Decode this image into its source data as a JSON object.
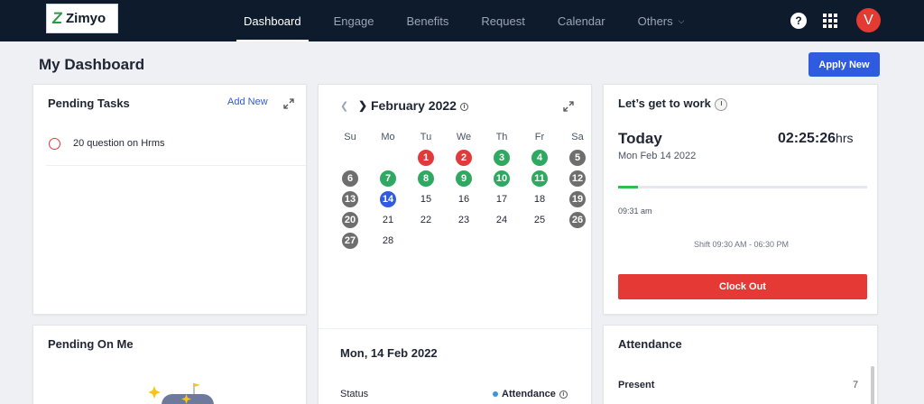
{
  "brand": {
    "name": "Zimyo"
  },
  "nav": {
    "items": [
      {
        "label": "Dashboard",
        "active": true
      },
      {
        "label": "Engage",
        "active": false
      },
      {
        "label": "Benefits",
        "active": false
      },
      {
        "label": "Request",
        "active": false
      },
      {
        "label": "Calendar",
        "active": false
      },
      {
        "label": "Others",
        "active": false
      }
    ],
    "help_glyph": "?",
    "avatar_initial": "V"
  },
  "page": {
    "title": "My Dashboard",
    "apply_new": "Apply New"
  },
  "pending_tasks": {
    "title": "Pending Tasks",
    "add_new": "Add New",
    "items": [
      "20 question on Hrms"
    ]
  },
  "calendar": {
    "month": "February 2022",
    "weekdays": [
      "Su",
      "Mo",
      "Tu",
      "We",
      "Th",
      "Fr",
      "Sa"
    ],
    "leading_blanks": 2,
    "days": [
      {
        "d": "1",
        "s": "absent"
      },
      {
        "d": "2",
        "s": "absent"
      },
      {
        "d": "3",
        "s": "present"
      },
      {
        "d": "4",
        "s": "present"
      },
      {
        "d": "5",
        "s": "off"
      },
      {
        "d": "6",
        "s": "off"
      },
      {
        "d": "7",
        "s": "present"
      },
      {
        "d": "8",
        "s": "present"
      },
      {
        "d": "9",
        "s": "present"
      },
      {
        "d": "10",
        "s": "present"
      },
      {
        "d": "11",
        "s": "present"
      },
      {
        "d": "12",
        "s": "off"
      },
      {
        "d": "13",
        "s": "off"
      },
      {
        "d": "14",
        "s": "today"
      },
      {
        "d": "15",
        "s": "plain"
      },
      {
        "d": "16",
        "s": "plain"
      },
      {
        "d": "17",
        "s": "plain"
      },
      {
        "d": "18",
        "s": "plain"
      },
      {
        "d": "19",
        "s": "off"
      },
      {
        "d": "20",
        "s": "off"
      },
      {
        "d": "21",
        "s": "plain"
      },
      {
        "d": "22",
        "s": "plain"
      },
      {
        "d": "23",
        "s": "plain"
      },
      {
        "d": "24",
        "s": "plain"
      },
      {
        "d": "25",
        "s": "plain"
      },
      {
        "d": "26",
        "s": "off"
      },
      {
        "d": "27",
        "s": "off"
      },
      {
        "d": "28",
        "s": "plain"
      }
    ],
    "selected_date": "Mon, 14 Feb 2022",
    "status_label": "Status",
    "status_value": "Attendance",
    "colors": {
      "absent": "#e03a3a",
      "present": "#2fa862",
      "off": "#6e6e6e",
      "today": "#2f5be0"
    }
  },
  "work": {
    "title": "Let’s get to work",
    "today_label": "Today",
    "timer": "02:25:26",
    "timer_unit": "hrs",
    "date": "Mon Feb 14 2022",
    "progress_pct": 8,
    "clock_in": "09:31 am",
    "shift": "Shift 09:30 AM - 06:30 PM",
    "clock_out": "Clock Out"
  },
  "pending_on_me": {
    "title": "Pending On Me"
  },
  "attendance": {
    "title": "Attendance",
    "present_label": "Present",
    "present_value": "7"
  }
}
